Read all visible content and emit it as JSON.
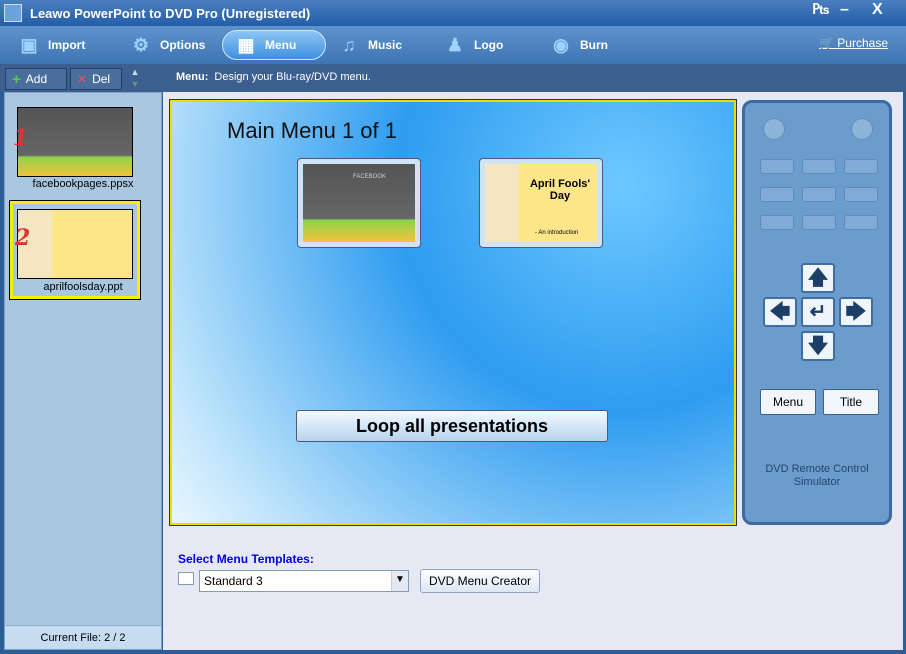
{
  "window": {
    "title": "Leawo PowerPoint to DVD Pro (Unregistered)"
  },
  "toolbar": {
    "items": [
      {
        "label": "Import",
        "icon": "import-icon"
      },
      {
        "label": "Options",
        "icon": "gear-icon"
      },
      {
        "label": "Menu",
        "icon": "menu-icon",
        "active": true
      },
      {
        "label": "Music",
        "icon": "music-icon"
      },
      {
        "label": "Logo",
        "icon": "logo-icon"
      },
      {
        "label": "Burn",
        "icon": "burn-disc-icon"
      }
    ],
    "purchase": "Purchase"
  },
  "subbar": {
    "add": "Add",
    "del": "Del",
    "hint_label": "Menu:",
    "hint_text": "Design your Blu-ray/DVD menu."
  },
  "files": {
    "items": [
      {
        "num": "1",
        "name": "facebookpages.ppsx"
      },
      {
        "num": "2",
        "name": "aprilfoolsday.ppt",
        "selected": true
      }
    ],
    "current": "Current File: 2 / 2"
  },
  "preview": {
    "title": "Main Menu 1 of 1",
    "slide2_title": "April Fools' Day",
    "slide2_sub": "- An introduction",
    "slide1_title": "FACEBOOK",
    "loop": "Loop all presentations"
  },
  "remote": {
    "menu": "Menu",
    "title": "Title",
    "label": "DVD Remote Control Simulator"
  },
  "templates": {
    "label": "Select Menu Templates:",
    "selected": "Standard 3",
    "creator": "DVD Menu Creator"
  }
}
